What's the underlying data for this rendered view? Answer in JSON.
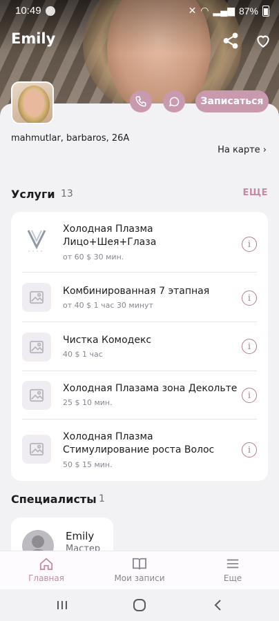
{
  "status_bar": {
    "time": "10:49",
    "battery": "87%"
  },
  "header": {
    "title": "Emily"
  },
  "actions": {
    "book_label": "Записаться"
  },
  "location": {
    "address": "mahmutlar, barbaros, 26A",
    "map_link": "На карте ›"
  },
  "services": {
    "title": "Услуги",
    "count": "13",
    "more_label": "ЕЩЕ",
    "items": [
      {
        "name": "Холодная Плазма Лицо+Шея+Глаза",
        "meta": "от 60 $  30 мин."
      },
      {
        "name": "Комбинированная 7 этапная",
        "meta": "от 40 $  1 час 30 минут"
      },
      {
        "name": "Чистка Комодекс",
        "meta": "40 $  1 час"
      },
      {
        "name": "Холодная Плазама зона Декольте",
        "meta": "25 $  10 мин."
      },
      {
        "name": "Холодная Плазма Стимулирование роста Волос",
        "meta": "50 $  15 мин."
      }
    ]
  },
  "specialists": {
    "title": "Специалисты",
    "count": "1",
    "items": [
      {
        "name": "Emily",
        "role": "Мастер"
      }
    ]
  },
  "bottom_nav": {
    "home": "Главная",
    "bookings": "Мои записи",
    "more": "Еще"
  },
  "colors": {
    "accent": "#c99aae",
    "accent_text": "#c58aa3",
    "background": "#f2f1f4"
  }
}
